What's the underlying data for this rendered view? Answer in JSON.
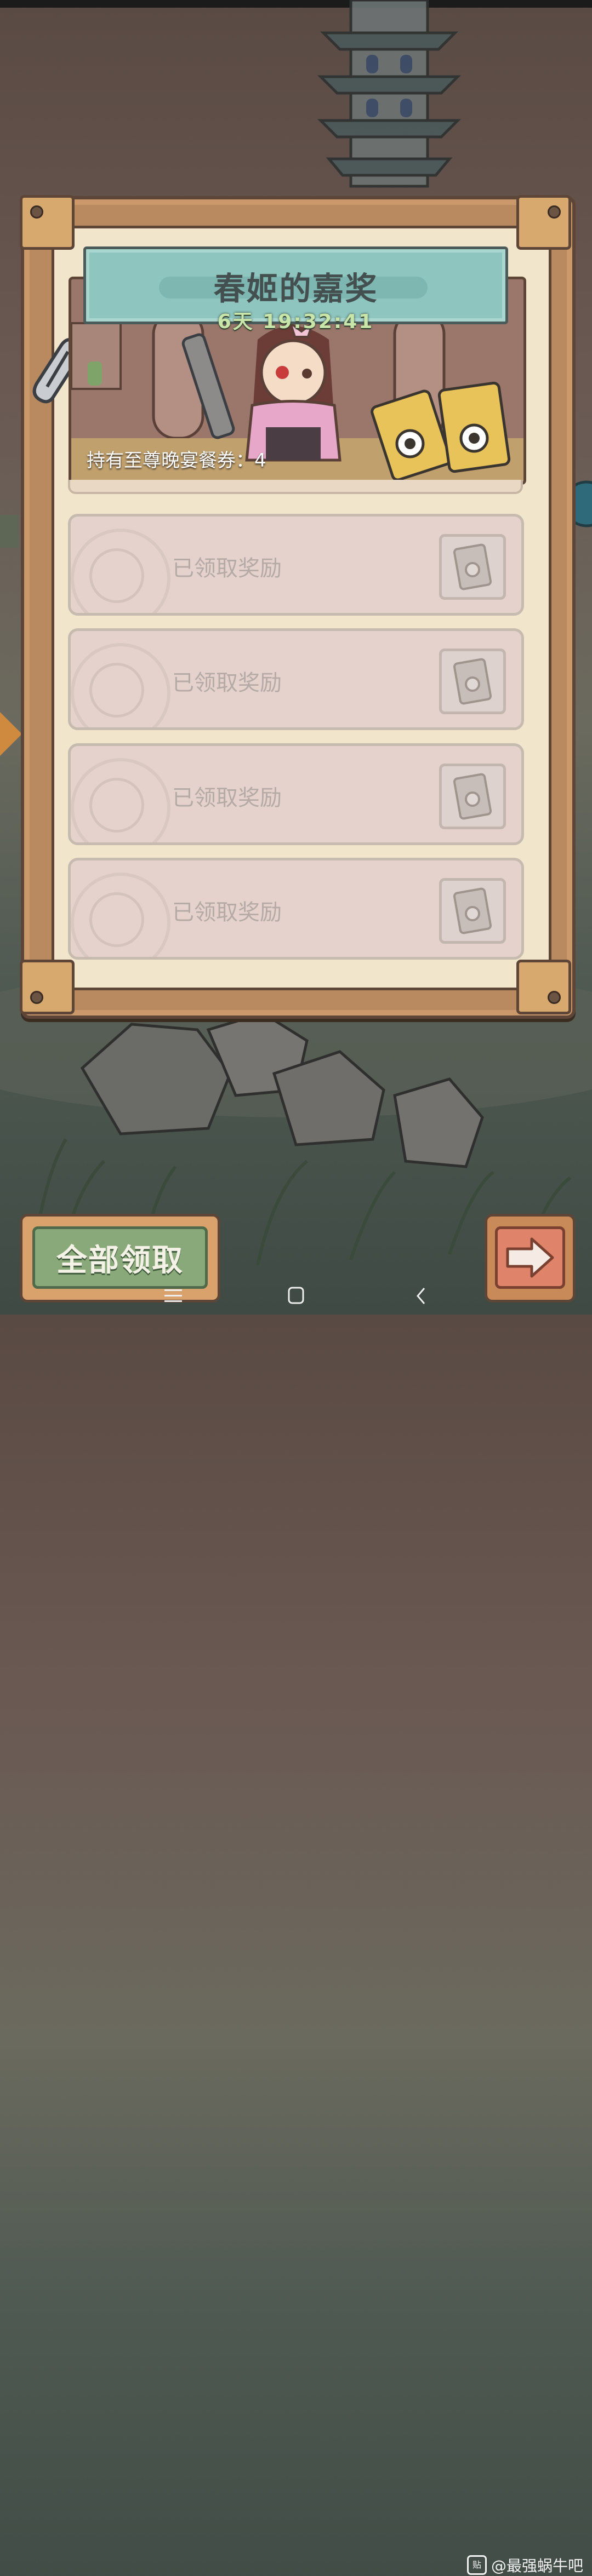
{
  "game": {
    "title": "春姬的嘉奖",
    "timer": "6天 19:32:41",
    "ticket_text": "持有至尊晚宴餐券：4"
  },
  "rewards": [
    {
      "label": "已领取奖励",
      "status": "claimed"
    },
    {
      "label": "已领取奖励",
      "status": "claimed"
    },
    {
      "label": "已领取奖励",
      "status": "claimed"
    },
    {
      "label": "已领取奖励",
      "status": "claimed"
    }
  ],
  "buttons": {
    "claim_all": "全部领取"
  },
  "system": {
    "watermark": "@最强蜗牛吧",
    "watermark_icon": "贴"
  },
  "colors": {
    "board": "#b98a5f",
    "title_plate": "#8ec5bf",
    "row_claimed": "#e5d2cc",
    "claim_button": "#8aa97a"
  }
}
